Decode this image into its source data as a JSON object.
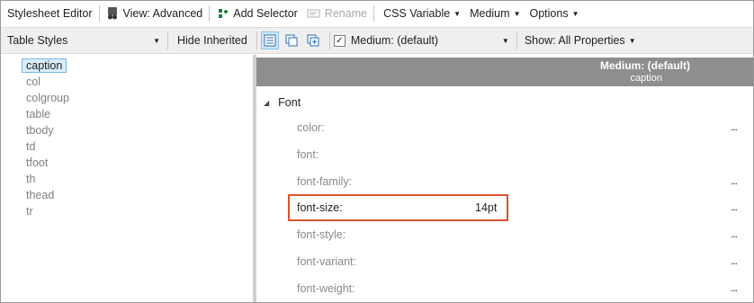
{
  "toolbar": {
    "title": "Stylesheet Editor",
    "view_label": "View: Advanced",
    "add_selector_label": "Add Selector",
    "rename_label": "Rename",
    "css_variable_label": "CSS Variable",
    "medium_label": "Medium",
    "options_label": "Options"
  },
  "toolbar2": {
    "styles_combo": "Table Styles",
    "hide_inherited_label": "Hide Inherited",
    "medium_combo": "Medium: (default)",
    "show_label": "Show: All Properties"
  },
  "selectors": [
    "caption",
    "col",
    "colgroup",
    "table",
    "tbody",
    "td",
    "tfoot",
    "th",
    "thead",
    "tr"
  ],
  "selected_selector": "caption",
  "panel": {
    "medium_header": "Medium: (default)",
    "selector_header": "caption",
    "group_label": "Font"
  },
  "properties": [
    {
      "name": "color:",
      "value": "",
      "dots": "..."
    },
    {
      "name": "font:",
      "value": "",
      "dots": ""
    },
    {
      "name": "font-family:",
      "value": "",
      "dots": "..."
    },
    {
      "name": "font-size:",
      "value": "14pt",
      "dots": "..."
    },
    {
      "name": "font-style:",
      "value": "",
      "dots": "..."
    },
    {
      "name": "font-variant:",
      "value": "",
      "dots": "..."
    },
    {
      "name": "font-weight:",
      "value": "",
      "dots": "..."
    }
  ],
  "colors": {
    "highlight_border": "#d9542b",
    "header_gray": "#8e8e8e",
    "selection_bg": "#d9ecfa"
  },
  "icons": [
    "glasses-icon",
    "add-selector-icon",
    "rename-icon",
    "list-view-icon",
    "copy-icon",
    "add-copy-icon",
    "checkbox-icon",
    "caret-down-icon"
  ]
}
